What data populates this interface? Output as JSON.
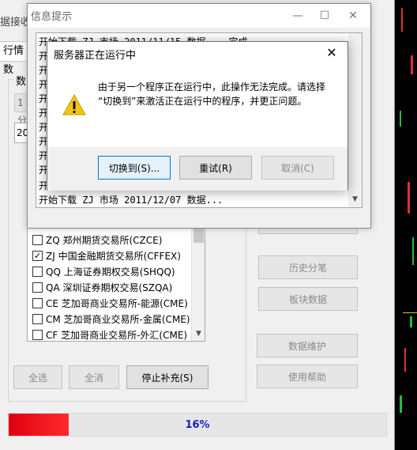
{
  "main": {
    "title_fragment": "据接收",
    "tab_fragment": "行情数",
    "group_fragment": "数",
    "combo_fragment": "1分",
    "date_fragment": "20"
  },
  "markets": [
    {
      "label": "ZQ  郑州期货交易所(CZCE)",
      "checked": false
    },
    {
      "label": "ZJ  中国金融期货交易所(CFFEX)",
      "checked": true
    },
    {
      "label": "QQ  上海证券期权交易(SHQQ)",
      "checked": false
    },
    {
      "label": "QA  深圳证券期权交易(SZQA)",
      "checked": false
    },
    {
      "label": "CE  芝加哥商业交易所-能源(CME)",
      "checked": false
    },
    {
      "label": "CM  芝加哥商业交易所-金属(CME)",
      "checked": false
    },
    {
      "label": "CF  芝加哥商业交易所-外汇(CME)",
      "checked": false
    }
  ],
  "bottom_buttons": {
    "select_all": "全选",
    "clear_all": "全消",
    "stop_fill": "停止补充(S)"
  },
  "side_buttons": {
    "history_tick": "历史分笔",
    "sector_data": "板块数据",
    "data_maintenance": "数据维护",
    "help": "使用帮助"
  },
  "progress": {
    "percent": 16,
    "text": "16%"
  },
  "info_dialog": {
    "title": "信息提示",
    "log_top": "开始下载 ZJ 市场 2011/11/15 数据... 完成。",
    "log_fragment": "开",
    "log_bottom": "开始下载 ZJ 市场 2011/12/07 数据..."
  },
  "server_dialog": {
    "title": "服务器正在运行中",
    "message_line1": "由于另一个程序正在运行中，此操作无法完成。请选择",
    "message_line2": "“切换到”来激活正在运行中的程序，并更正问题。",
    "switch_button": "切换到(S)...",
    "retry_button": "重试(R)",
    "cancel_button": "取消(C)"
  },
  "colors": {
    "progress_fill": "#e00010",
    "progress_text": "#1a1acc",
    "focus_border": "#0078d7",
    "warning_yellow": "#f2c511"
  },
  "icons": [
    "warning-icon",
    "close-icon",
    "minimize-icon",
    "maximize-icon",
    "checkbox-icon"
  ]
}
